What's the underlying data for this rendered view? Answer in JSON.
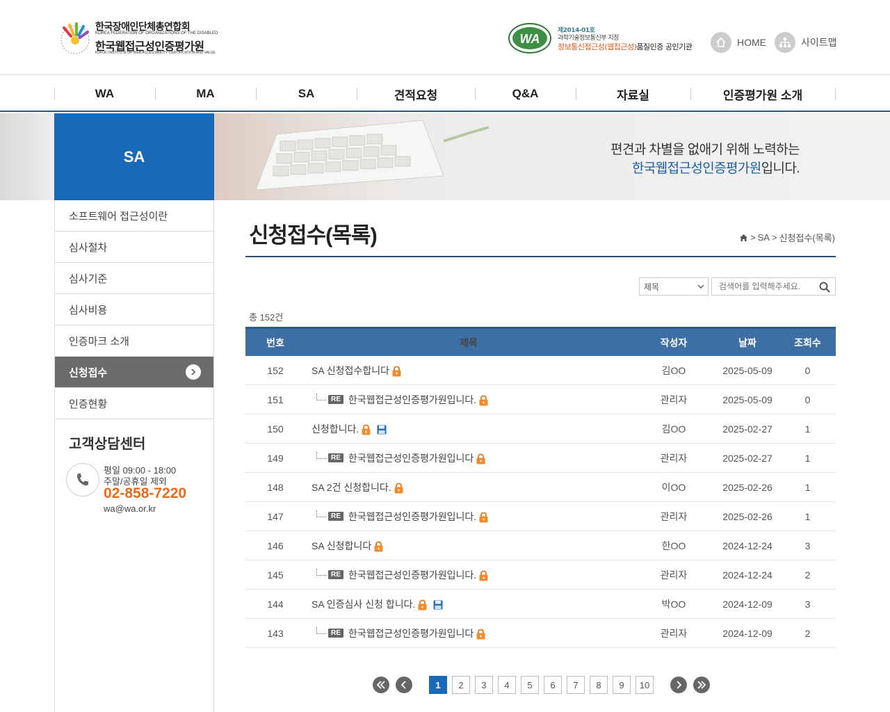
{
  "header": {
    "logo": {
      "prefix": "사단법인",
      "org_ko": "한국장애인단체총연합회",
      "org_en": "KOREA FEDERATION OF ORGANIZATIONS OF THE DISABLED",
      "inst_ko": "한국웹접근성인증평가원",
      "inst_en": "KOFOD INSTITUTE OF WEB ACCESSIBILITY CERTIFICATION AND VALUE"
    },
    "wa_badge": {
      "line1": "제2014-01호",
      "line2": "과학기술정보통신부 지정",
      "line3_colored": "정보통신접근성(웹접근성)",
      "line3_rest": "품질인증 공인기관"
    },
    "home_label": "HOME",
    "sitemap_label": "사이트맵"
  },
  "gnb": {
    "items": [
      {
        "label": "WA"
      },
      {
        "label": "MA"
      },
      {
        "label": "SA"
      },
      {
        "label": "견적요청"
      },
      {
        "label": "Q&A"
      },
      {
        "label": "자료실"
      },
      {
        "label": "인증평가원 소개"
      }
    ]
  },
  "visual": {
    "section_title": "SA",
    "line1": "편견과 차별을 없애기 위해 노력하는",
    "line2_blue": "한국웹접근성인증평가원",
    "line2_rest": "입니다."
  },
  "lnb": {
    "items": [
      {
        "label": "소프트웨어 접근성이란",
        "active": false
      },
      {
        "label": "심사절차",
        "active": false
      },
      {
        "label": "심사기준",
        "active": false
      },
      {
        "label": "심사비용",
        "active": false
      },
      {
        "label": "인증마크 소개",
        "active": false
      },
      {
        "label": "신청접수",
        "active": true
      },
      {
        "label": "인증현황",
        "active": false
      }
    ]
  },
  "customer_center": {
    "title": "고객상담센터",
    "hours": "평일 09:00 - 18:00",
    "closed": "주말/공휴일 제외",
    "phone": "02-858-7220",
    "email": "wa@wa.or.kr"
  },
  "content": {
    "page_title": "신청접수(목록)",
    "breadcrumb": [
      "SA",
      "신청접수(목록)"
    ],
    "search": {
      "select_value": "제목",
      "placeholder": "검색어를 입력해주세요."
    },
    "total": "총 152건",
    "columns": [
      "번호",
      "제목",
      "작성자",
      "날짜",
      "조회수"
    ],
    "rows": [
      {
        "no": "152",
        "title": "SA 신청접수합니다",
        "reply": false,
        "file": false,
        "author": "김OO",
        "date": "2025-05-09",
        "views": "0"
      },
      {
        "no": "151",
        "title": "한국웹접근성인증평가원입니다.",
        "reply": true,
        "file": false,
        "author": "관리자",
        "date": "2025-05-09",
        "views": "0"
      },
      {
        "no": "150",
        "title": "신청합니다.",
        "reply": false,
        "file": true,
        "author": "김OO",
        "date": "2025-02-27",
        "views": "1"
      },
      {
        "no": "149",
        "title": "한국웹접근성인증평가원입니다",
        "reply": true,
        "file": false,
        "author": "관리자",
        "date": "2025-02-27",
        "views": "1"
      },
      {
        "no": "148",
        "title": "SA 2건 신청합니다.",
        "reply": false,
        "file": false,
        "author": "이OO",
        "date": "2025-02-26",
        "views": "1"
      },
      {
        "no": "147",
        "title": "한국웹접근성인증평가원입니다.",
        "reply": true,
        "file": false,
        "author": "관리자",
        "date": "2025-02-26",
        "views": "1"
      },
      {
        "no": "146",
        "title": "SA 신청합니다",
        "reply": false,
        "file": false,
        "author": "한OO",
        "date": "2024-12-24",
        "views": "3"
      },
      {
        "no": "145",
        "title": "한국웹접근성인증평가원입니다.",
        "reply": true,
        "file": false,
        "author": "관리자",
        "date": "2024-12-24",
        "views": "2"
      },
      {
        "no": "144",
        "title": "SA 인증심사 신청 합니다.",
        "reply": false,
        "file": true,
        "author": "박OO",
        "date": "2024-12-09",
        "views": "3"
      },
      {
        "no": "143",
        "title": "한국웹접근성인증평가원입니다",
        "reply": true,
        "file": false,
        "author": "관리자",
        "date": "2024-12-09",
        "views": "2"
      }
    ],
    "re_label": "RE",
    "pagination": {
      "pages": [
        "1",
        "2",
        "3",
        "4",
        "5",
        "6",
        "7",
        "8",
        "9",
        "10"
      ],
      "current": "1"
    }
  },
  "colors": {
    "brand_blue": "#1869b7",
    "table_header": "#3d6fa5",
    "phone_orange": "#e86a1b",
    "lock_orange": "#f08a2a"
  }
}
